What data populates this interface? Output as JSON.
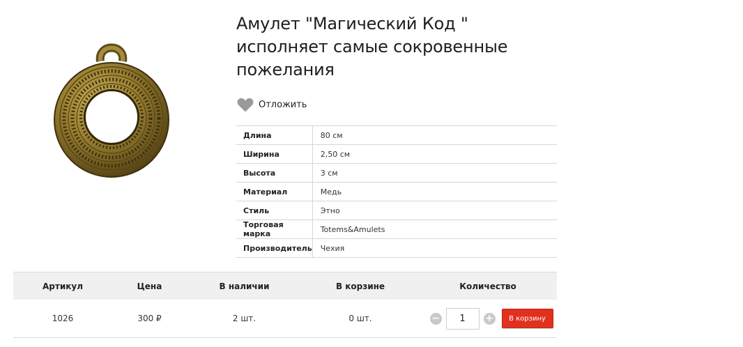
{
  "product": {
    "title": "Амулет \"Магический Код \" исполняет самые сокровенные пожелания",
    "wishlist_label": "Отложить"
  },
  "properties": [
    {
      "key": "Длина",
      "value": "80 см"
    },
    {
      "key": "Ширина",
      "value": "2,50 см"
    },
    {
      "key": "Высота",
      "value": "3 см"
    },
    {
      "key": "Материал",
      "value": "Медь"
    },
    {
      "key": "Стиль",
      "value": "Этно"
    },
    {
      "key": "Торговая марка",
      "value": "Totems&Amulets"
    },
    {
      "key": "Производитель",
      "value": "Чехия"
    }
  ],
  "purchase": {
    "headers": {
      "sku": "Артикул",
      "price": "Цена",
      "stock": "В наличии",
      "in_cart": "В корзине",
      "quantity": "Количество"
    },
    "row": {
      "sku": "1026",
      "price": "300 ₽",
      "stock": "2 шт.",
      "in_cart": "0 шт.",
      "quantity": "1"
    },
    "minus_label": "−",
    "plus_label": "+",
    "add_to_cart_label": "В корзину"
  },
  "icons": {
    "wishlist": "heart-icon",
    "decrease": "minus-icon",
    "increase": "plus-icon"
  },
  "colors": {
    "accent": "#e0301e",
    "amulet": "#8a7228",
    "header_bg": "#f0f0f0"
  }
}
